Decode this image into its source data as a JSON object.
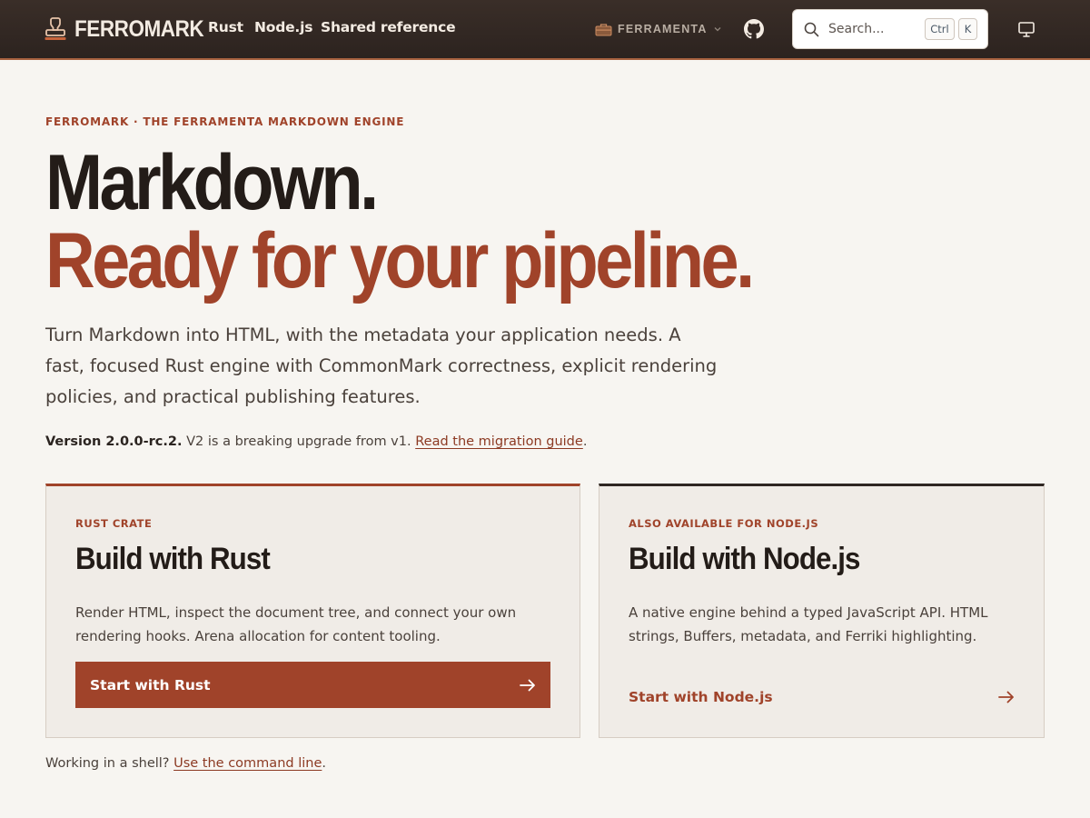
{
  "header": {
    "brand": "FERROMARK",
    "nav": [
      {
        "label": "Rust"
      },
      {
        "label": "Node.js"
      },
      {
        "label": "Shared reference"
      }
    ],
    "org_switcher": {
      "label": "FERRAMENTA",
      "icon": "toolbox-icon"
    },
    "github_icon": "github-icon",
    "search": {
      "placeholder": "Search...",
      "shortcut_keys": [
        "Ctrl",
        "K"
      ]
    },
    "display_icon": "monitor-icon"
  },
  "hero": {
    "eyebrow": "FERROMARK · THE FERRAMENTA MARKDOWN ENGINE",
    "title_line1": "Markdown.",
    "title_line2": "Ready for your pipeline.",
    "lede": "Turn Markdown into HTML, with the metadata your application needs. A fast, focused Rust engine with CommonMark correctness, explicit rendering policies, and practical publishing features.",
    "version_strong": "Version 2.0.0-rc.2.",
    "version_text": " V2 is a breaking upgrade from v1. ",
    "version_link": "Read the migration guide",
    "version_end": "."
  },
  "cards": [
    {
      "kicker": "RUST CRATE",
      "title": "Build with Rust",
      "description": "Render HTML, inspect the document tree, and connect your own rendering hooks. Arena allocation for content tooling.",
      "cta": "Start with Rust"
    },
    {
      "kicker": "ALSO AVAILABLE FOR NODE.JS",
      "title": "Build with Node.js",
      "description": "A native engine behind a typed JavaScript API. HTML strings, Buffers, metadata, and Ferriki highlighting.",
      "cta": "Start with Node.js"
    }
  ],
  "shell": {
    "text": "Working in a shell? ",
    "link": "Use the command line",
    "end": "."
  },
  "colors": {
    "accent": "#a0432a",
    "header_bg": "#2c231f",
    "page_bg": "#f7f5f1",
    "card_bg": "#f0ece7",
    "ink": "#231c18"
  }
}
